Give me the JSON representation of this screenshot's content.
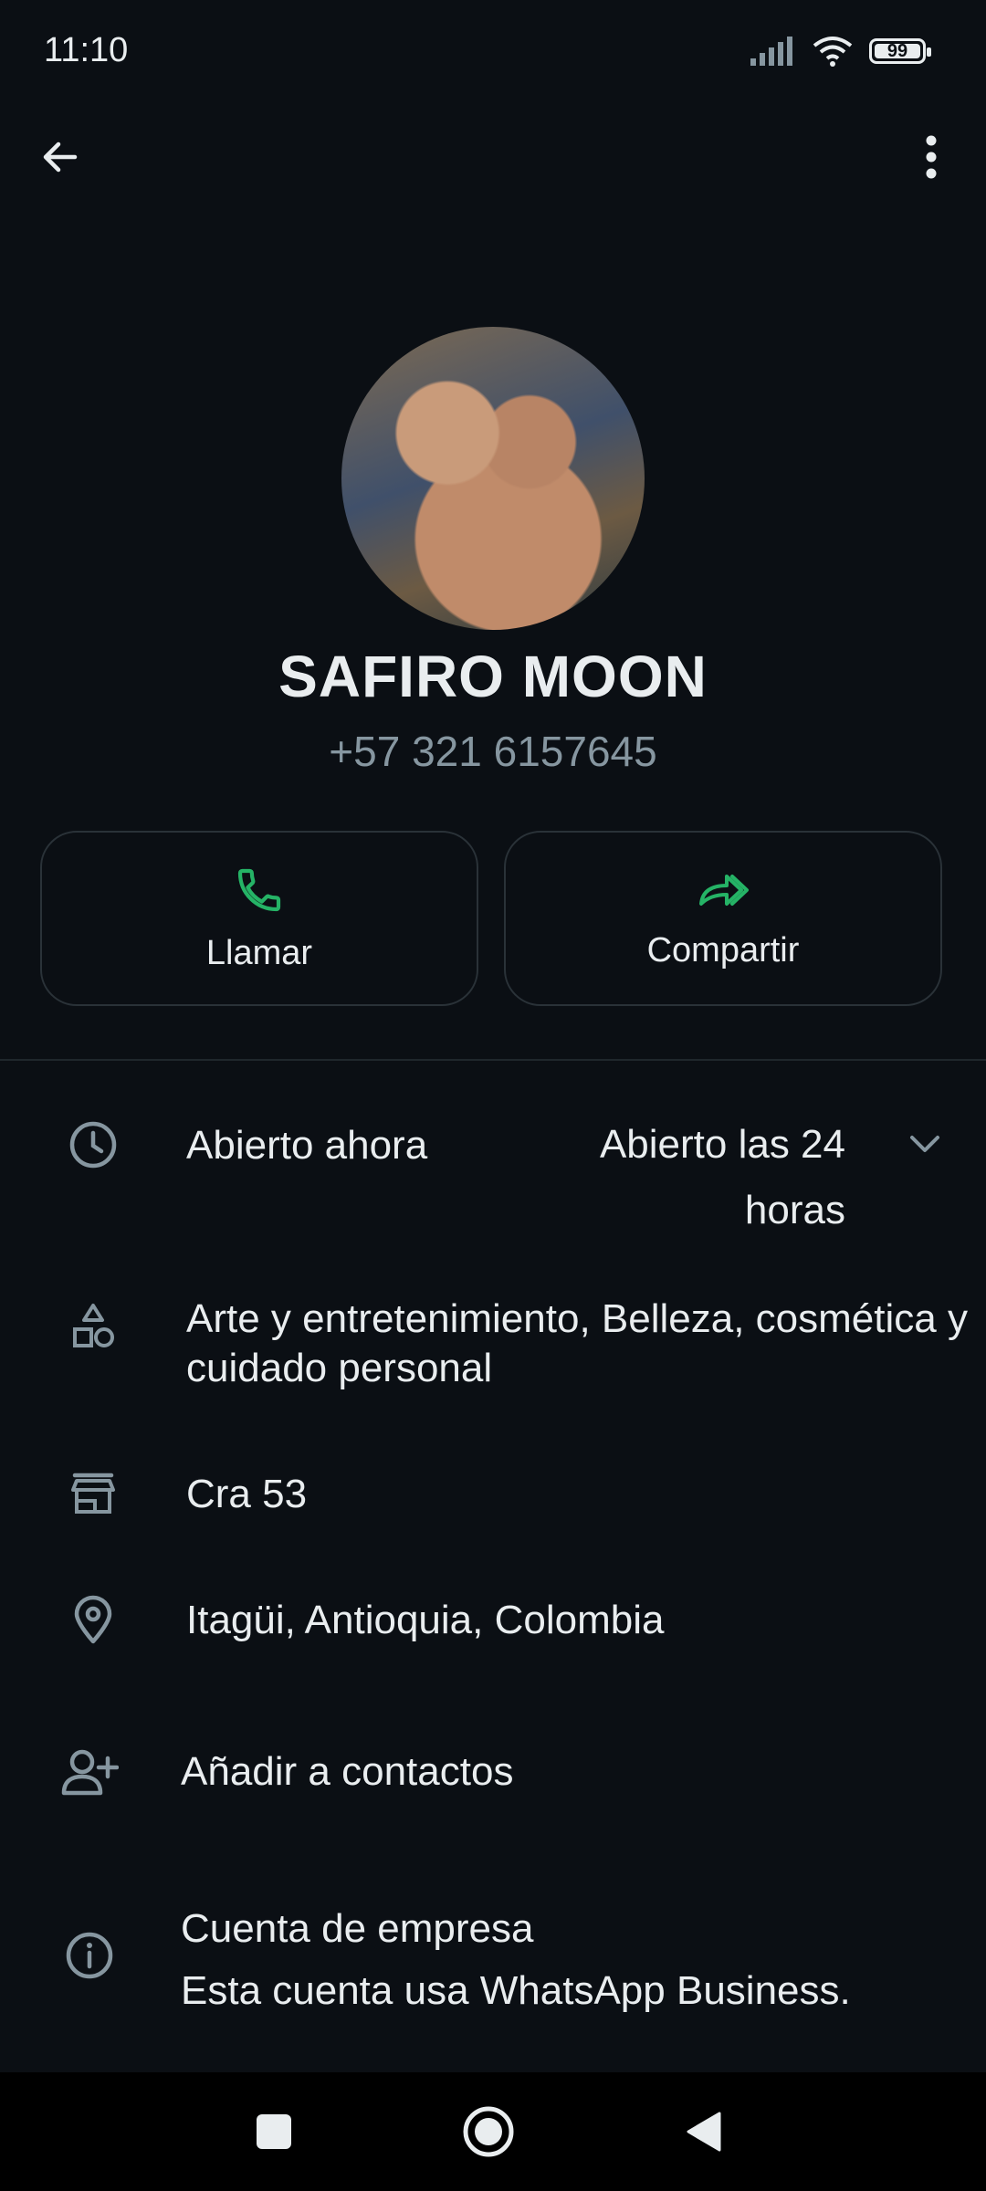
{
  "status_bar": {
    "time": "11:10",
    "battery": "99"
  },
  "profile": {
    "name": "SAFIRO MOON",
    "phone": "+57 321 6157645"
  },
  "actions": {
    "call_label": "Llamar",
    "share_label": "Compartir"
  },
  "hours": {
    "status": "Abierto ahora",
    "detail": "Abierto las 24 horas"
  },
  "category": "Arte y entretenimiento, Belleza, cosmética y cuidado personal",
  "address": "Cra 53",
  "location": "Itagüi, Antioquia, Colombia",
  "add_contact_label": "Añadir a contactos",
  "business_account": {
    "title": "Cuenta de empresa",
    "subtitle": "Esta cuenta usa WhatsApp Business."
  },
  "colors": {
    "accent_green": "#25b366",
    "link_blue": "#53bdeb",
    "background": "#0b0f14"
  }
}
